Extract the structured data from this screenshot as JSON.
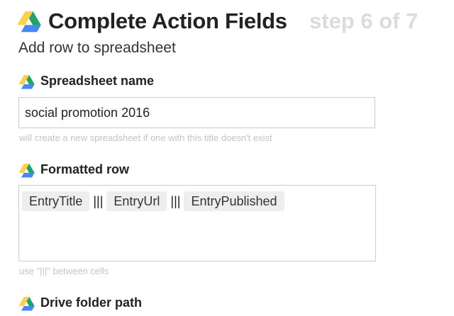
{
  "header": {
    "title": "Complete Action Fields",
    "step": "step 6 of 7"
  },
  "action_name": "Add row to spreadsheet",
  "colors": {
    "drive_green": "#1FA463",
    "drive_yellow": "#FFD04B",
    "drive_blue": "#4688F4",
    "step_gray": "#dcdcdc"
  },
  "fields": {
    "spreadsheet_name": {
      "label": "Spreadsheet name",
      "icon": "google-drive-icon",
      "value": "social promotion 2016",
      "helper": "will create a new spreadsheet if one with this title doesn't exist"
    },
    "formatted_row": {
      "label": "Formatted row",
      "icon": "google-drive-icon",
      "ingredients": [
        "EntryTitle",
        "EntryUrl",
        "EntryPublished"
      ],
      "separator": "|||",
      "helper": "use \"|||\" between cells"
    },
    "drive_folder_path": {
      "label": "Drive folder path",
      "icon": "google-drive-icon"
    }
  }
}
